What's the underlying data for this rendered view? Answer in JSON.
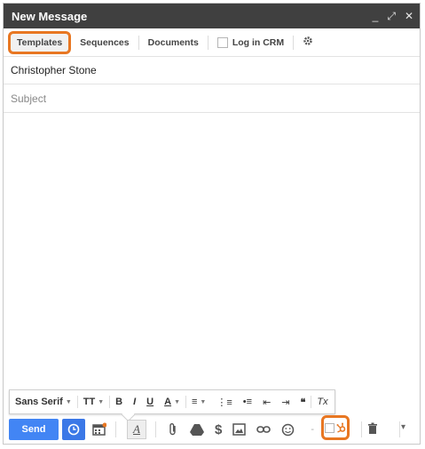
{
  "window": {
    "title": "New Message"
  },
  "title_controls": {
    "minimize": "_",
    "popout": "⤢",
    "close": "✕"
  },
  "extensions": {
    "templates": "Templates",
    "sequences": "Sequences",
    "documents": "Documents",
    "log_in_crm": "Log in CRM"
  },
  "fields": {
    "to_value": "Christopher Stone",
    "subject_placeholder": "Subject"
  },
  "format": {
    "font": "Sans Serif",
    "size_icon": "TT",
    "bold": "B",
    "italic": "I",
    "underline": "U",
    "text_color": "A",
    "align": "≡",
    "numbered": "⋮≡",
    "bulleted": "•≡",
    "indent_less": "⇤",
    "indent_more": "⇥",
    "quote": "❝",
    "clear": "Tx"
  },
  "bottom": {
    "send": "Send",
    "format_toggle": "A",
    "dash": "-",
    "more": "▾"
  },
  "colors": {
    "accent": "#e87722",
    "send_blue": "#4285f4",
    "titlebar": "#404040"
  }
}
